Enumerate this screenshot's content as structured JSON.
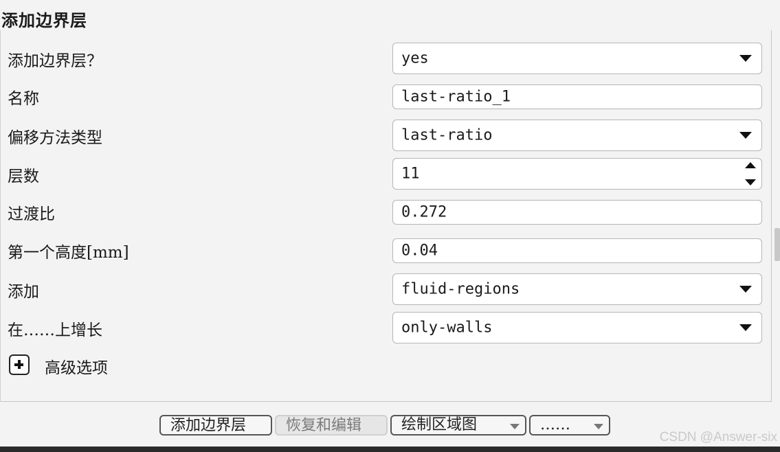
{
  "title": "添加边界层",
  "rows": [
    {
      "label": "添加边界层？",
      "value": "yes",
      "control": "dropdown"
    },
    {
      "label": "名称",
      "value": "last-ratio_1",
      "control": "text"
    },
    {
      "label": "偏移方法类型",
      "value": "last-ratio",
      "control": "dropdown"
    },
    {
      "label": "层数",
      "value": "11",
      "control": "spinner"
    },
    {
      "label": "过渡比",
      "value": "0.272",
      "control": "text"
    },
    {
      "label": "第一个高度[mm]",
      "value": "0.04",
      "control": "text"
    },
    {
      "label": "添加",
      "value": "fluid-regions",
      "control": "dropdown"
    },
    {
      "label": "在……上增长",
      "value": "only-walls",
      "control": "dropdown"
    }
  ],
  "advanced": {
    "label": "高级选项",
    "icon": "plus-icon"
  },
  "buttons": {
    "add_label": "添加边界层",
    "revert_label": "恢复和编辑",
    "draw_label": "绘制区域图",
    "more_label": "……"
  },
  "watermark": "CSDN @Answer-six"
}
